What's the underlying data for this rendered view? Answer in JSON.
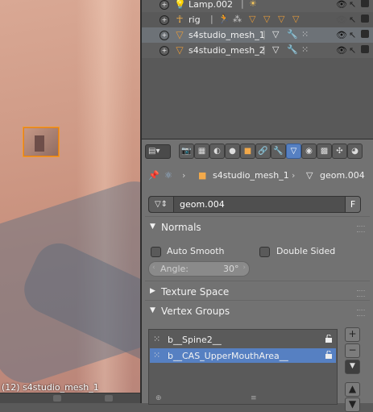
{
  "viewport": {
    "status_text": "(12) s4studio_mesh_1"
  },
  "outliner": {
    "rows": [
      {
        "name": "Lamp.002",
        "icon": "lamp-icon"
      },
      {
        "name": "rig",
        "icon": "armature-icon"
      },
      {
        "name": "s4studio_mesh_1",
        "icon": "mesh-icon",
        "selected": true
      },
      {
        "name": "s4studio_mesh_2",
        "icon": "mesh-icon"
      }
    ]
  },
  "properties": {
    "breadcrumb": {
      "object": "s4studio_mesh_1",
      "data": "geom.004"
    },
    "mesh_datablock": {
      "value": "geom.004",
      "fake_user": "F"
    },
    "panels": {
      "normals": {
        "title": "Normals",
        "auto_smooth": "Auto Smooth",
        "double_sided": "Double Sided",
        "angle_label": "Angle:",
        "angle_value": "30°"
      },
      "texture_space": {
        "title": "Texture Space"
      },
      "vertex_groups": {
        "title": "Vertex Groups",
        "items": [
          {
            "name": "b__Spine2__"
          },
          {
            "name": "b__CAS_UpperMouthArea__",
            "selected": true
          }
        ]
      }
    }
  },
  "colors": {
    "selection": "#5680c2",
    "object_outline": "#f39a29"
  }
}
